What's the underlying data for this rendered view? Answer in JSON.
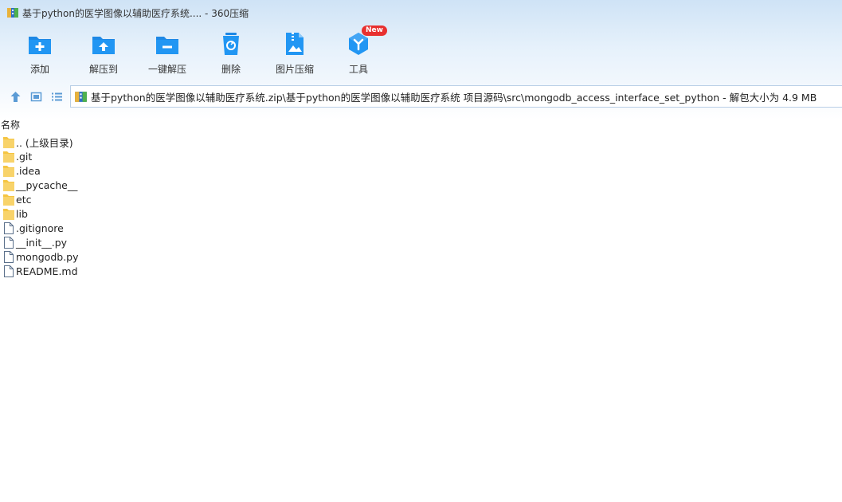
{
  "window": {
    "title": "基于python的医学图像以辅助医疗系统.... - 360压缩"
  },
  "toolbar": {
    "items": [
      {
        "id": "add",
        "label": "添加",
        "icon": "add-icon"
      },
      {
        "id": "extract-to",
        "label": "解压到",
        "icon": "extract-to-icon"
      },
      {
        "id": "one-click-extract",
        "label": "一键解压",
        "icon": "one-click-extract-icon"
      },
      {
        "id": "delete",
        "label": "删除",
        "icon": "trash-icon"
      },
      {
        "id": "image-compress",
        "label": "图片压缩",
        "icon": "image-compress-icon"
      },
      {
        "id": "tools",
        "label": "工具",
        "icon": "tools-icon",
        "badge": "New"
      }
    ]
  },
  "navbar": {
    "path": "基于python的医学图像以辅助医疗系统.zip\\基于python的医学图像以辅助医疗系统 项目源码\\src\\mongodb_access_interface_set_python - 解包大小为 4.9 MB"
  },
  "list": {
    "column_name": "名称",
    "items": [
      {
        "name": ".. (上级目录)",
        "type": "folder"
      },
      {
        "name": ".git",
        "type": "folder"
      },
      {
        "name": ".idea",
        "type": "folder"
      },
      {
        "name": "__pycache__",
        "type": "folder"
      },
      {
        "name": "etc",
        "type": "folder"
      },
      {
        "name": "lib",
        "type": "folder"
      },
      {
        "name": ".gitignore",
        "type": "file"
      },
      {
        "name": "__init__.py",
        "type": "file"
      },
      {
        "name": "mongodb.py",
        "type": "file"
      },
      {
        "name": "README.md",
        "type": "file"
      }
    ]
  },
  "colors": {
    "accent": "#1e88e5",
    "folder": "#f5c542",
    "badge": "#e8302f"
  }
}
